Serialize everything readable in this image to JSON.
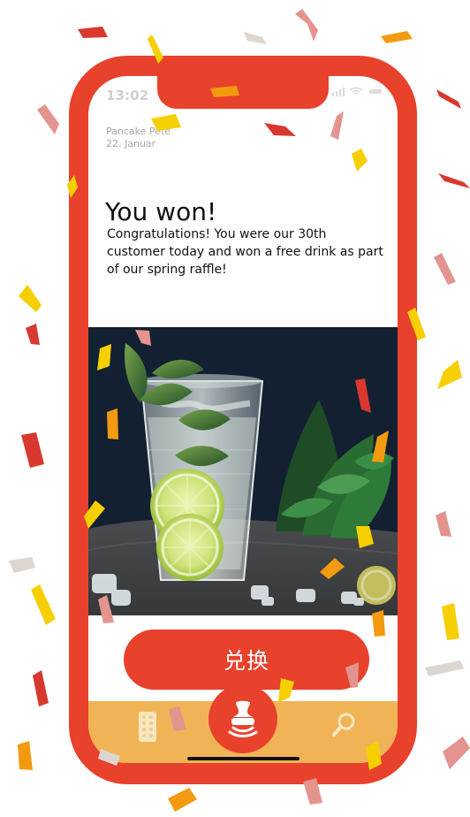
{
  "status_bar": {
    "time": "13:02",
    "signal_icon": "signal-icon",
    "wifi_icon": "wifi-icon",
    "battery_icon": "battery-icon"
  },
  "message": {
    "restaurant": "Pancake Pete",
    "date": "22. Januar",
    "title": "You won!",
    "body": "Congratulations! You were our 30th customer today and won a free drink as part of our spring raffle!"
  },
  "image": {
    "icon": "mojito-drink-photo"
  },
  "actions": {
    "redeem_label": "兑换"
  },
  "navigation": {
    "cards_icon": "cards-icon",
    "stamp_icon": "stamp-icon",
    "search_icon": "search-icon"
  },
  "colors": {
    "accent": "#e8412c",
    "bar": "#f0b457",
    "confetti_yellow": "#f6cf00",
    "confetti_orange": "#f39a10",
    "confetti_red": "#d9382f",
    "confetti_pink": "#e4948f",
    "confetti_gray": "#ddd6d0"
  }
}
